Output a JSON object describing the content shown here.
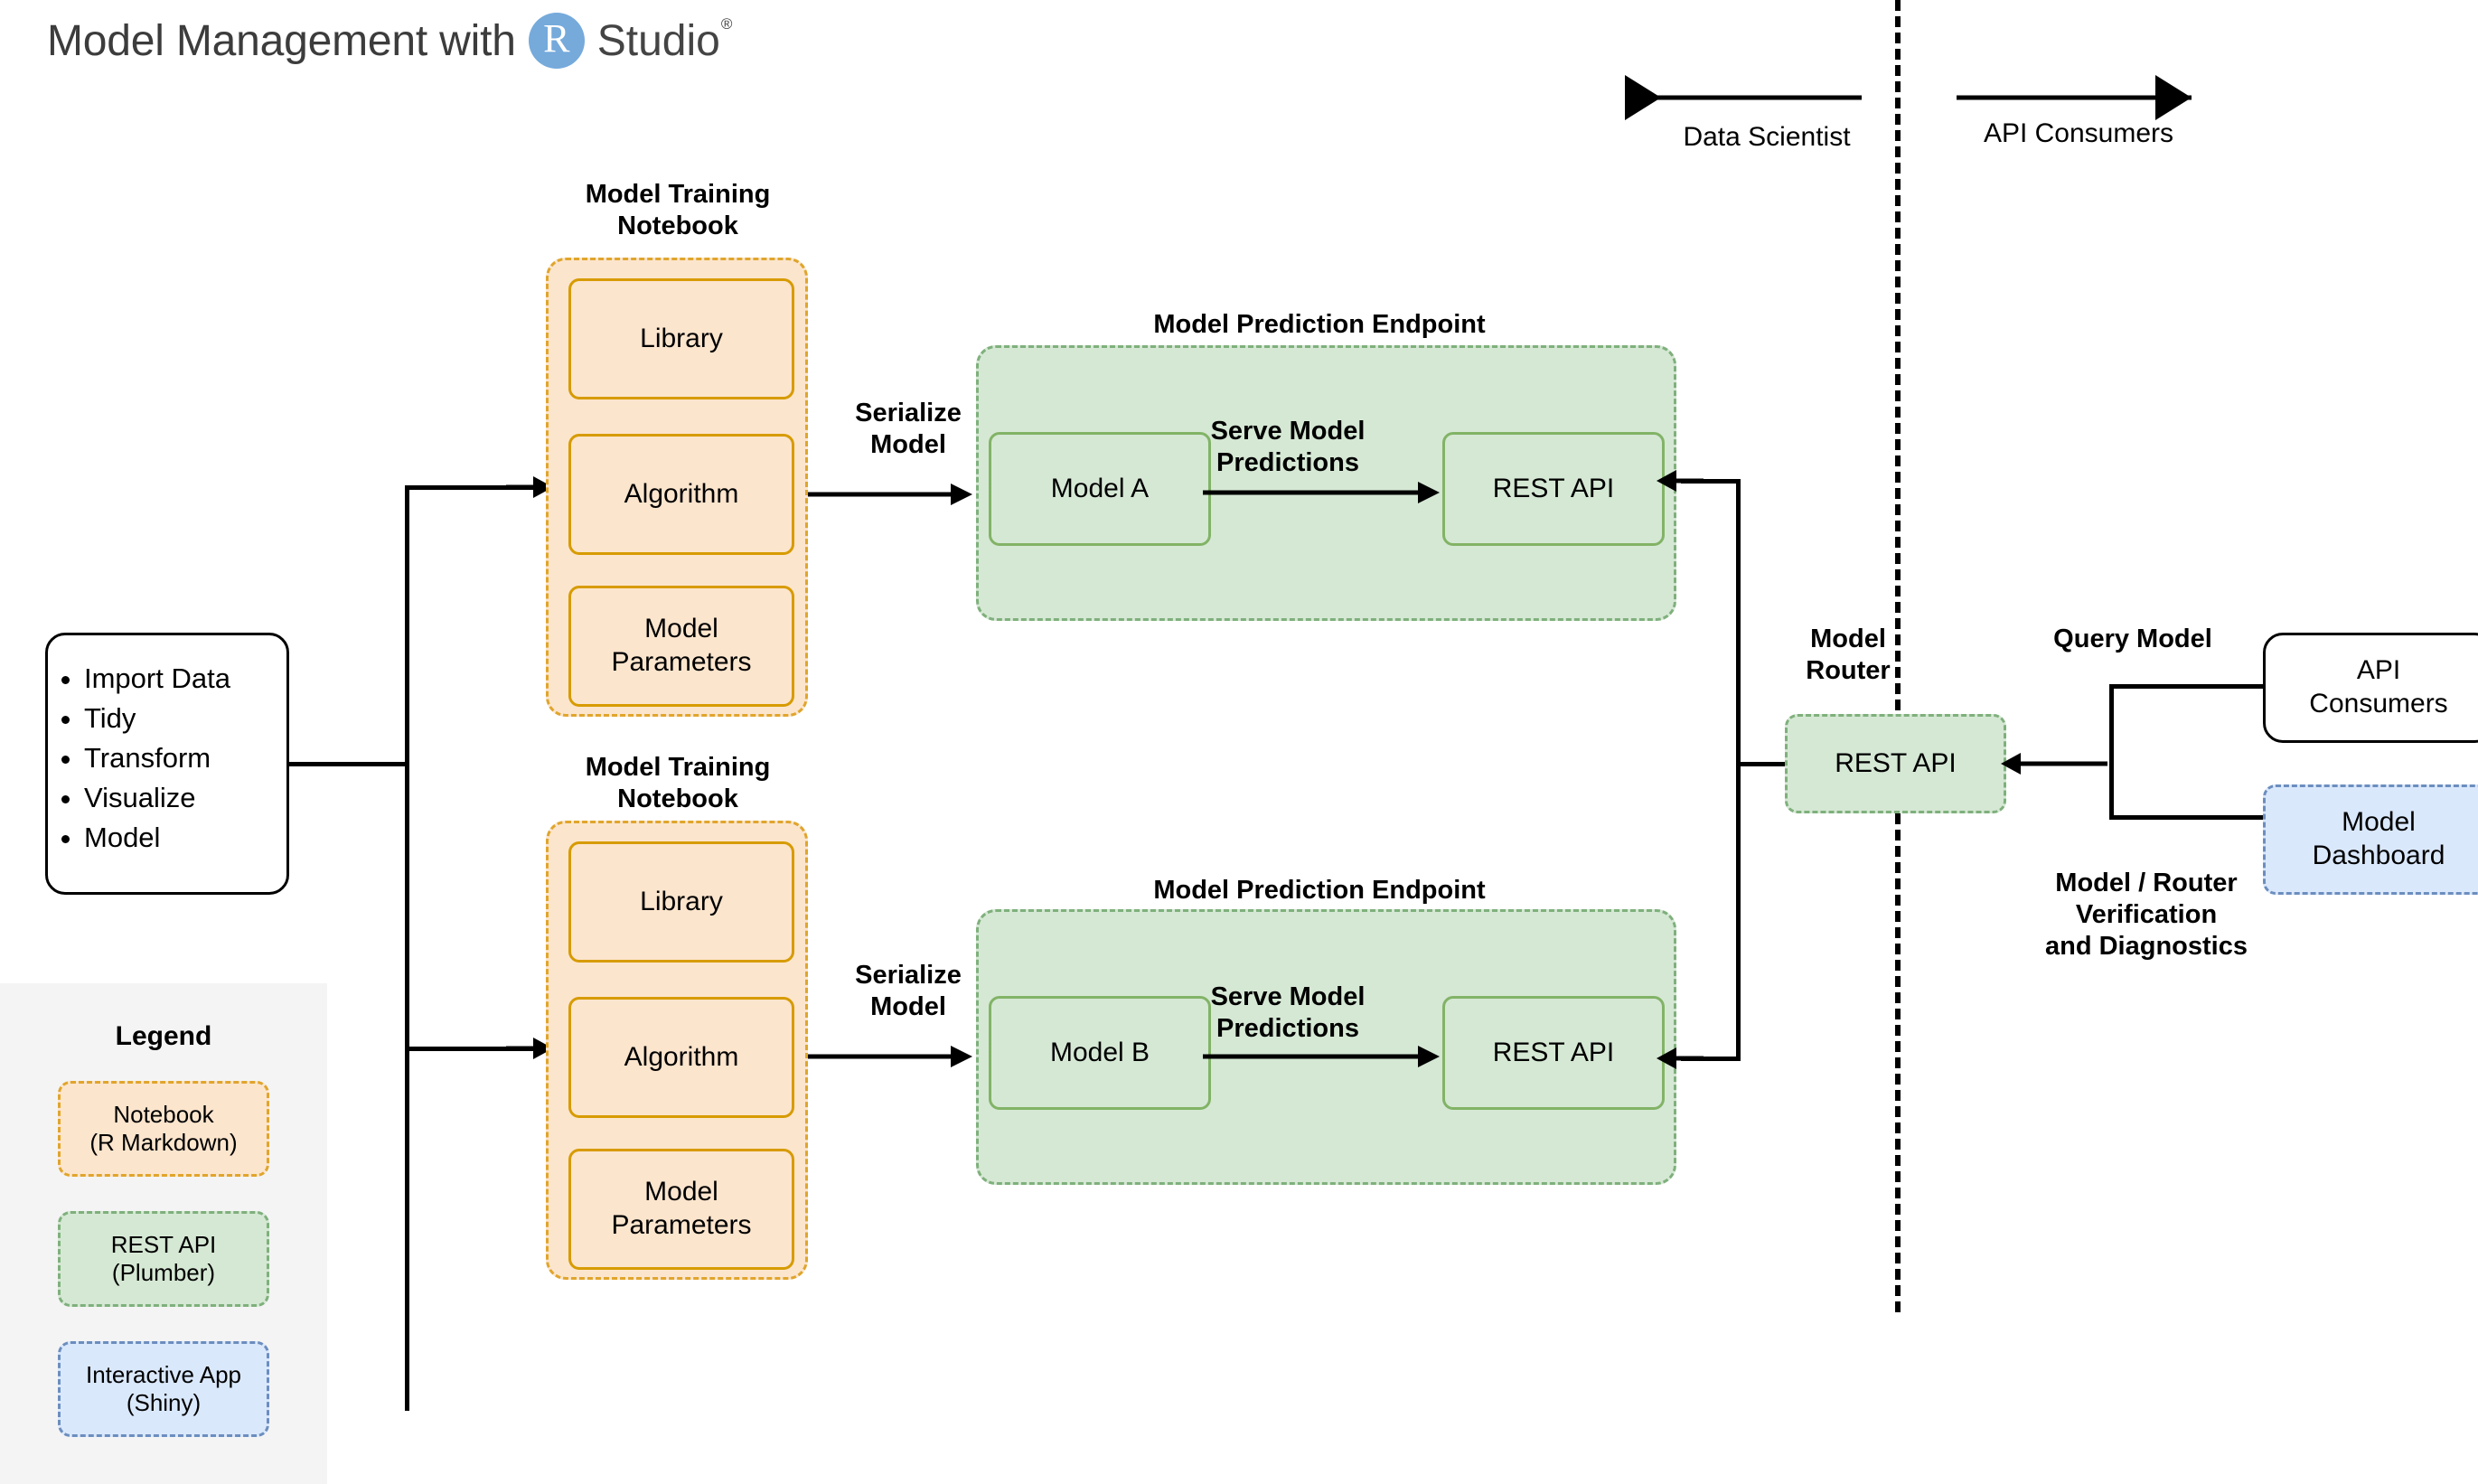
{
  "header": {
    "title_prefix": "Model Management with",
    "logo_letter": "R",
    "logo_word": "Studio",
    "logo_reg": "®",
    "logo_color": "#75AADB"
  },
  "top_divider": {
    "left_label": "Data Scientist",
    "right_label": "API Consumers"
  },
  "data_node": {
    "items": [
      "Import Data",
      "Tidy",
      "Transform",
      "Visualize",
      "Model"
    ]
  },
  "notebooks": [
    {
      "title": "Model Training\nNotebook",
      "blocks": [
        "Library",
        "Algorithm",
        "Model\nParameters"
      ]
    },
    {
      "title": "Model Training\nNotebook",
      "blocks": [
        "Library",
        "Algorithm",
        "Model\nParameters"
      ]
    }
  ],
  "serialize_labels": [
    "Serialize\nModel",
    "Serialize\nModel"
  ],
  "endpoints": [
    {
      "title": "Model Prediction Endpoint",
      "model_label": "Model A",
      "arrow_label": "Serve Model\nPredictions",
      "api_label": "REST API"
    },
    {
      "title": "Model Prediction Endpoint",
      "model_label": "Model B",
      "arrow_label": "Serve Model\nPredictions",
      "api_label": "REST API"
    }
  ],
  "router": {
    "title": "Model\nRouter",
    "api_label": "REST API"
  },
  "consumers": {
    "query_label": "Query Model",
    "api_consumers_label": "API\nConsumers",
    "dashboard_label": "Model\nDashboard",
    "verification_label": "Model / Router\nVerification\nand Diagnostics"
  },
  "legend": {
    "title": "Legend",
    "items": [
      {
        "label": "Notebook\n(R Markdown)",
        "fill": "#FCE5CD",
        "border": "#E0A52C"
      },
      {
        "label": "REST API\n(Plumber)",
        "fill": "#D5E8D4",
        "border": "#7FB07C"
      },
      {
        "label": "Interactive App\n(Shiny)",
        "fill": "#DAE8FC",
        "border": "#6C8EBF"
      }
    ]
  }
}
